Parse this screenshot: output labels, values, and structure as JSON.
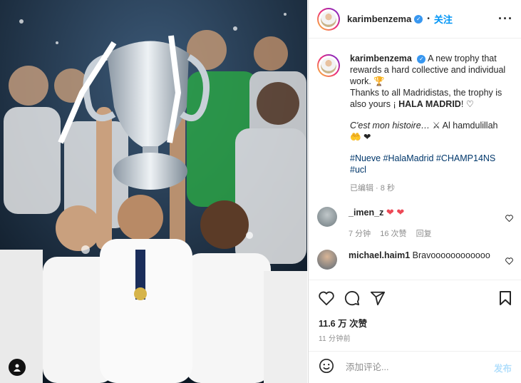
{
  "post_author": {
    "username": "karimbenzema",
    "follow_label": "关注",
    "separator": "•",
    "more_label": "···"
  },
  "caption": {
    "username": "karimbenzema",
    "line1": "A new trophy that rewards a hard collective and individual work.",
    "line1_emoji": "🏆",
    "line2_prefix": "Thanks to all Madridistas, the trophy is also yours ¡ ",
    "line2_bold": "HALA MADRID",
    "line2_suffix": "! ♡",
    "line3_italic": "C'est mon histoire…",
    "line3_emoji": "⚔",
    "line3_rest": "Al hamdulillah",
    "line3_emoji2": "🤲 ❤",
    "hashtags": "#Nueve #HalaMadrid #CHAMP14NS #ucl",
    "meta": "已编辑 · 8 秒"
  },
  "comments": [
    {
      "username": "_imen_z",
      "text": "❤ ❤",
      "time": "7 分钟",
      "likes": "16 次赞",
      "reply": "回复"
    },
    {
      "username": "michael.haim1",
      "text": "Bravoooooooooooo"
    }
  ],
  "likes": "11.6 万 次赞",
  "posted_ago": "11 分钟前",
  "add_comment": {
    "placeholder": "添加评论...",
    "post_label": "发布"
  },
  "colors": {
    "accent": "#0095f6",
    "verified": "#3897f0",
    "heart": "#ed4956",
    "hashtag": "#00376b"
  }
}
